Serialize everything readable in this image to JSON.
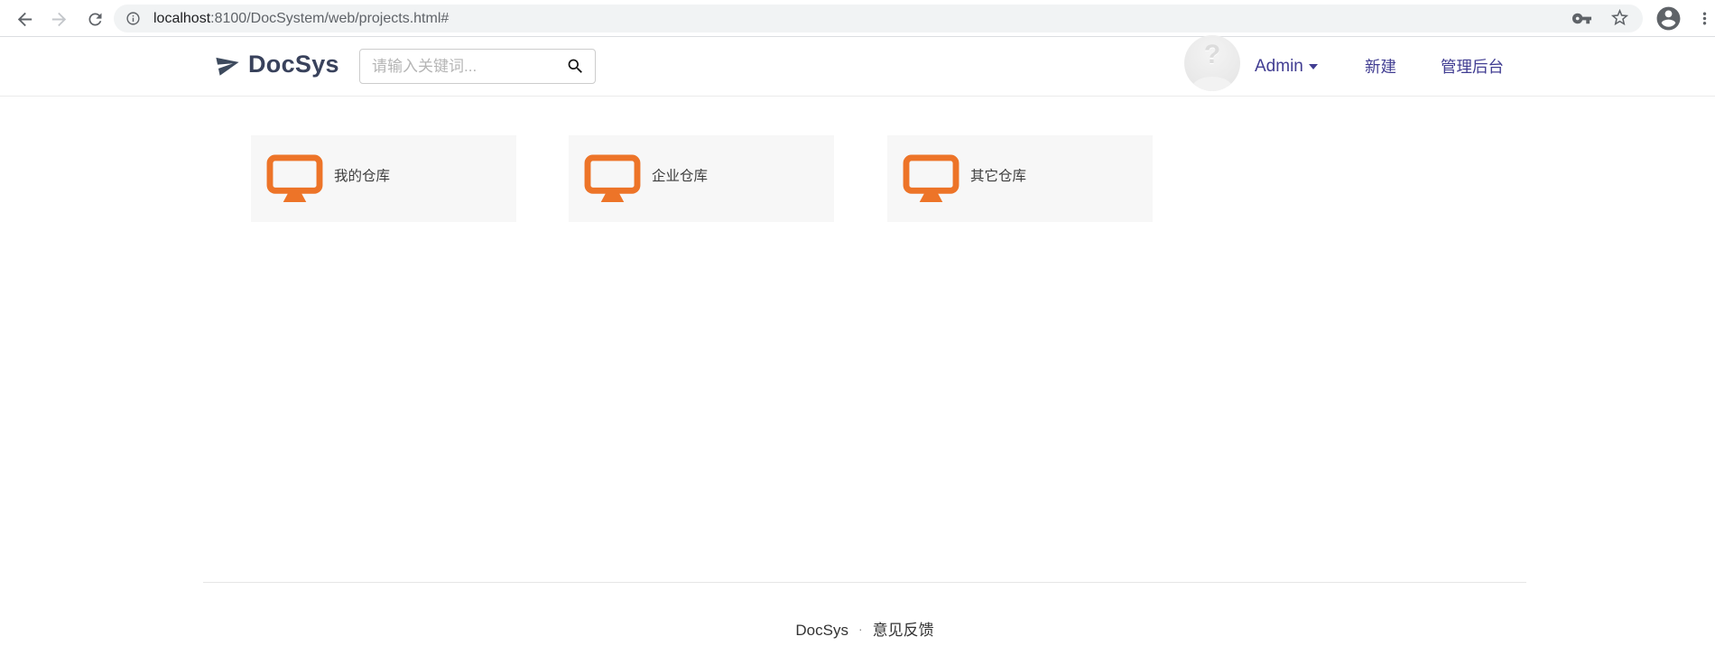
{
  "browser": {
    "url_host": "localhost",
    "url_rest": ":8100/DocSystem/web/projects.html#"
  },
  "header": {
    "brand": "DocSys",
    "search": {
      "placeholder": "请输入关键词..."
    },
    "user_dropdown": "Admin",
    "links": [
      {
        "label": "新建"
      },
      {
        "label": "管理后台"
      }
    ]
  },
  "main": {
    "cards": [
      {
        "label": "我的仓库"
      },
      {
        "label": "企业仓库"
      },
      {
        "label": "其它仓库"
      }
    ]
  },
  "footer": {
    "brand": "DocSys",
    "separator": "·",
    "feedback": "意见反馈"
  },
  "colors": {
    "accent_orange": "#ED7428",
    "nav_link": "#413D92",
    "brand_text": "#39425C",
    "chrome_icon": "#5F6368",
    "card_bg": "#F7F7F7"
  },
  "icons": {
    "back": "back-arrow-icon",
    "forward": "forward-arrow-icon",
    "reload": "reload-icon",
    "page_info": "info-icon",
    "key": "key-icon",
    "bookmark": "star-icon",
    "profile": "person-circle-icon",
    "menu": "vertical-dots-icon",
    "brand": "paper-plane-icon",
    "search": "magnifier-icon",
    "card": "monitor-icon",
    "avatar": "question-mark-avatar"
  }
}
